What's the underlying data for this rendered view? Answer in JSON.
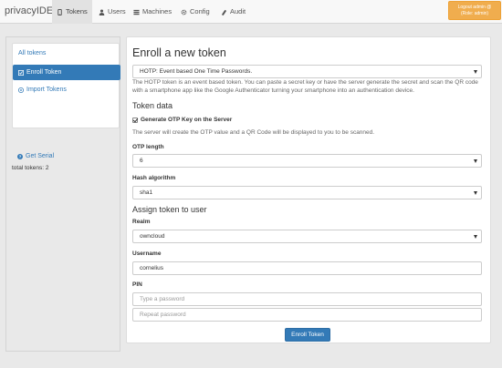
{
  "navbar": {
    "brand": "privacyIDEA",
    "items": [
      {
        "label": "Tokens",
        "icon": "mobile-icon",
        "active": true
      },
      {
        "label": "Users",
        "icon": "user-icon",
        "active": false
      },
      {
        "label": "Machines",
        "icon": "server-icon",
        "active": false
      },
      {
        "label": "Config",
        "icon": "gear-icon",
        "active": false
      },
      {
        "label": "Audit",
        "icon": "audit-icon",
        "active": false
      }
    ],
    "user_line1": "Logout admin @",
    "user_line2": "(Role: admin)"
  },
  "sidebar": {
    "items": [
      {
        "label": "All tokens",
        "icon": "",
        "active": false
      },
      {
        "label": "Enroll Token",
        "icon": "edit-icon",
        "active": true
      },
      {
        "label": "Import Tokens",
        "icon": "import-icon",
        "active": false
      }
    ],
    "get_serial": "Get Serial",
    "total": "total tokens: 2"
  },
  "main": {
    "title": "Enroll a new token",
    "token_type": "HOTP: Event based One Time Passwords.",
    "description": "The HOTP token is an event based token. You can paste a secret key or have the server generate the secret and scan the QR code with a smartphone app like the Google Authenticator turning your smartphone into an authentication device.",
    "token_data_heading": "Token data",
    "generate_label": "Generate OTP Key on the Server",
    "generate_checked": true,
    "generate_help": "The server will create the OTP value and a QR Code will be displayed to you to be scanned.",
    "otp_length_label": "OTP length",
    "otp_length_value": "6",
    "hash_label": "Hash algorithm",
    "hash_value": "sha1",
    "assign_heading": "Assign token to user",
    "realm_label": "Realm",
    "realm_value": "owncloud",
    "username_label": "Username",
    "username_value": "cornelius",
    "pin_label": "PIN",
    "pin_placeholder": "Type a password",
    "pin_repeat_placeholder": "Repeat password",
    "enroll_button": "Enroll Token"
  },
  "colors": {
    "primary": "#337ab7",
    "warning": "#f0ad4e",
    "navbar_bg": "#f8f8f8"
  }
}
